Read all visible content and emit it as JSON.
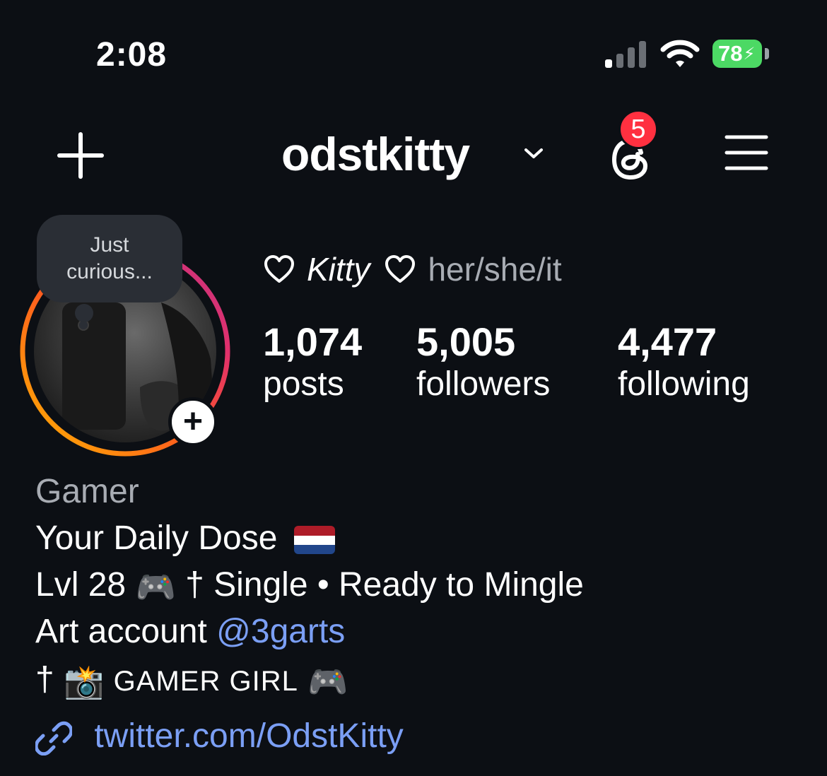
{
  "status_bar": {
    "time": "2:08",
    "battery_level": "78",
    "battery_color": "#4cd964"
  },
  "header": {
    "username": "odstkitty",
    "notification_count": "5",
    "badge_color": "#ff3040"
  },
  "note": {
    "line1": "Just",
    "line2": "curious..."
  },
  "profile": {
    "display_name": "Kitty",
    "pronouns": "her/she/it"
  },
  "stats": {
    "posts": {
      "value": "1,074",
      "label": "posts"
    },
    "followers": {
      "value": "5,005",
      "label": "followers"
    },
    "following": {
      "value": "4,477",
      "label": "following"
    }
  },
  "bio": {
    "category": "Gamer",
    "line1": "Your Daily Dose",
    "line2_a": "Lvl 28",
    "line2_b": "† Single • Ready to Mingle",
    "line3_a": "Art account",
    "line3_mention": "@3garts",
    "line4_a": "†",
    "line4_b": "GAMER GIRL",
    "link": "twitter.com/OdstKitty"
  },
  "icons": {
    "controller": "🎮",
    "camera_flash": "📸"
  },
  "colors": {
    "background": "#0c0f14",
    "link": "#7b9ff5",
    "secondary_text": "#a8acb3"
  }
}
